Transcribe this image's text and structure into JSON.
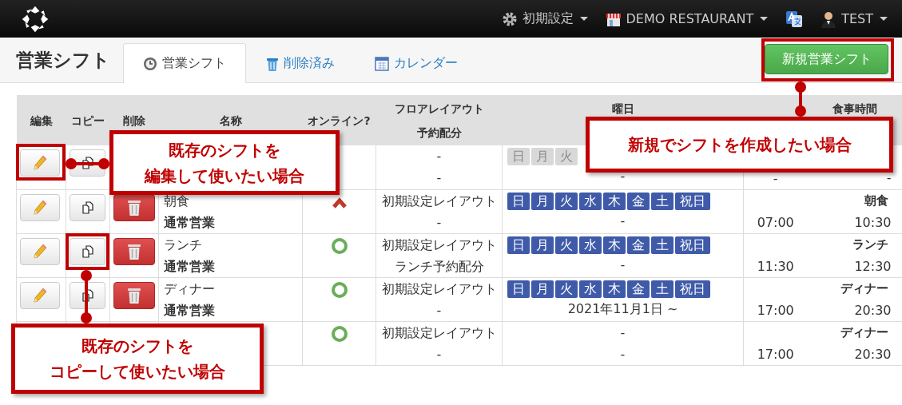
{
  "navbar": {
    "menus": [
      {
        "kind": "settings",
        "label": "初期設定"
      },
      {
        "kind": "store",
        "label": "DEMO RESTAURANT"
      },
      {
        "kind": "language"
      },
      {
        "kind": "user",
        "label": "TEST"
      }
    ]
  },
  "page_title": "営業シフト",
  "tabs": [
    {
      "kind": "clock",
      "label": "営業シフト",
      "selected": true
    },
    {
      "kind": "trash",
      "label": "削除済み",
      "selected": false
    },
    {
      "kind": "calendar",
      "label": "カレンダー",
      "selected": false
    }
  ],
  "new_button": "新規営業シフト",
  "table": {
    "columns": [
      {
        "lines": [
          "編集"
        ]
      },
      {
        "lines": [
          "コピー"
        ]
      },
      {
        "lines": [
          "削除"
        ]
      },
      {
        "lines": [
          "名称"
        ]
      },
      {
        "lines": [
          "オンライン?"
        ]
      },
      {
        "lines": [
          "フロアレイアウト",
          "予約配分"
        ]
      },
      {
        "lines": [
          "曜日"
        ]
      },
      {},
      {
        "lines": [
          "食事時間"
        ]
      }
    ],
    "rows": [
      {
        "edit": true,
        "copy": true,
        "delete": false,
        "layout": "-",
        "allocation": "-",
        "days": [
          "日",
          "月",
          "火"
        ],
        "days_active": false,
        "date": "-",
        "start": "-",
        "end": "-"
      },
      {
        "edit": true,
        "copy": true,
        "delete": true,
        "name": "朝食",
        "type": "通常営業",
        "online": false,
        "layout": "初期設定レイアウト",
        "allocation": "-",
        "days": [
          "日",
          "月",
          "火",
          "水",
          "木",
          "金",
          "土",
          "祝日"
        ],
        "days_active": true,
        "date": "-",
        "start": "07:00",
        "meal": "朝食",
        "end": "10:30"
      },
      {
        "edit": true,
        "copy": true,
        "delete": true,
        "name": "ランチ",
        "type": "通常営業",
        "online": true,
        "layout": "初期設定レイアウト",
        "allocation": "ランチ予約配分",
        "days": [
          "日",
          "月",
          "火",
          "水",
          "木",
          "金",
          "土",
          "祝日"
        ],
        "days_active": true,
        "date": "-",
        "start": "11:30",
        "meal": "ランチ",
        "end": "12:30"
      },
      {
        "edit": true,
        "copy": true,
        "delete": true,
        "name": "ディナー",
        "type": "通常営業",
        "online": true,
        "layout": "初期設定レイアウト",
        "allocation": "-",
        "days": [
          "日",
          "月",
          "火",
          "水",
          "木",
          "金",
          "土",
          "祝日"
        ],
        "days_active": true,
        "date": "2021年11月1日 ~",
        "start": "17:00",
        "meal": "ディナー",
        "end": "20:30"
      },
      {
        "edit": false,
        "copy": false,
        "delete": false,
        "online": true,
        "layout": "初期設定レイアウト",
        "allocation": "-",
        "day_note": "-",
        "date": "-",
        "start": "17:00",
        "meal": "ディナー",
        "end": "20:30"
      }
    ]
  },
  "callouts": [
    {
      "lines": [
        "既存のシフトを",
        "編集して使いたい場合"
      ]
    },
    {
      "lines": [
        "新規でシフトを作成したい場合"
      ]
    },
    {
      "lines": [
        "既存のシフトを",
        "コピーして使いたい場合"
      ]
    }
  ]
}
